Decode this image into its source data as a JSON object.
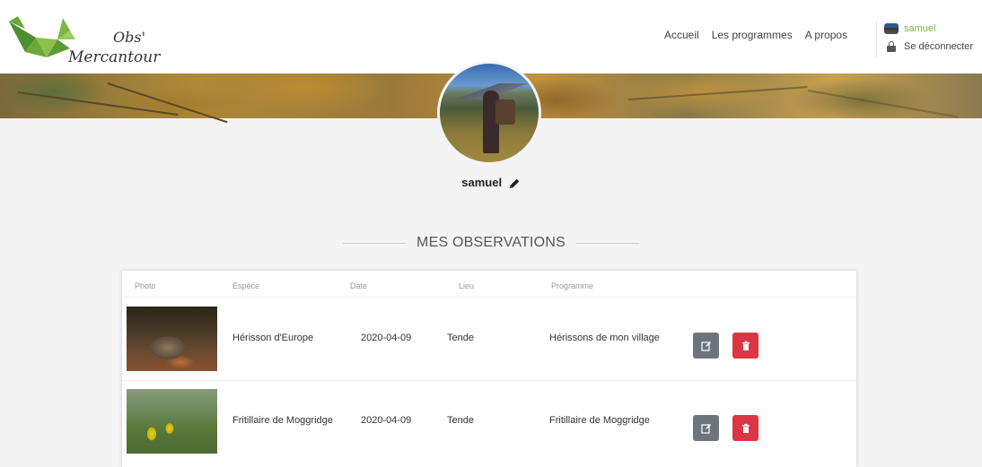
{
  "header": {
    "logo_line1": "Obs'",
    "logo_line2": "Mercantour",
    "nav": [
      "Accueil",
      "Les programmes",
      "A propos"
    ],
    "user": {
      "name": "samuel",
      "logout": "Se déconnecter"
    }
  },
  "profile": {
    "name": "samuel"
  },
  "section": {
    "title": "MES OBSERVATIONS"
  },
  "table": {
    "headers": [
      "Photo",
      "Espèce",
      "Date",
      "Lieu",
      "Programme"
    ],
    "rows": [
      {
        "species": "Hérisson d'Europe",
        "date": "2020-04-09",
        "place": "Tende",
        "program": "Hérissons de mon village"
      },
      {
        "species": "Fritillaire de Moggridge",
        "date": "2020-04-09",
        "place": "Tende",
        "program": "Fritillaire de Moggridge"
      }
    ]
  },
  "colors": {
    "accent_green": "#7bb542",
    "edit_button": "#6c757d",
    "delete_button": "#dc3545"
  },
  "icons": [
    "logo-fox-icon",
    "lock-icon",
    "pencil-icon",
    "edit-icon",
    "trash-icon"
  ]
}
